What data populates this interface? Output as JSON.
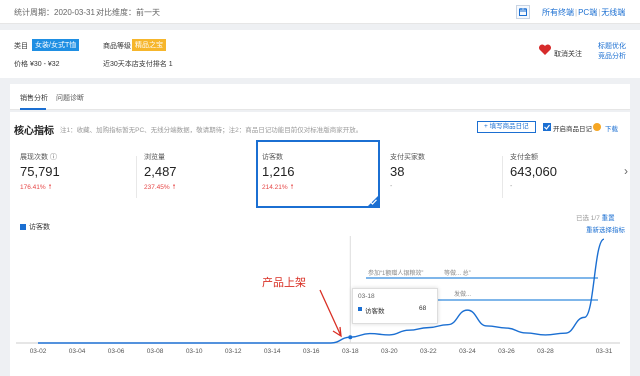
{
  "topbar": {
    "period_label": "统计周期：2020-03-31",
    "compare_label": "对比维度：前一天",
    "devices": [
      "所有终端",
      "PC端",
      "无线端"
    ]
  },
  "info": {
    "category_label": "类目",
    "category_tag": "女装/女式T恤",
    "level_label": "商品等级",
    "level_tag": "精品之宝",
    "price": "价格  ¥30 - ¥32",
    "rank": "近30天本店支付排名  1",
    "follow": "取消关注",
    "link1": "标题优化",
    "link2": "竞品分析"
  },
  "tabs": [
    "销售分析",
    "问题诊断"
  ],
  "panel": {
    "title": "核心指标",
    "note": "注1：收藏、加购指标暂无PC、无线分端数据，敬请期待；注2：商品日记功能目前仅对标准版商家开放。",
    "add_diary": "+ 填写商品日记",
    "show_diary": "开启商品日记",
    "download": "下载",
    "legend": "访客数",
    "chosen_prefix": "已选 1/7 ",
    "reset": "重置",
    "replace": "重新选择指标",
    "annotation": "产品上架"
  },
  "metrics": [
    {
      "label": "展现次数 ⓘ",
      "value": "75,791",
      "change": "176.41%"
    },
    {
      "label": "浏览量",
      "value": "2,487",
      "change": "237.45%"
    },
    {
      "label": "访客数",
      "value": "1,216",
      "change": "214.21%"
    },
    {
      "label": "支付买家数",
      "value": "38",
      "change": ""
    },
    {
      "label": "支付金额",
      "value": "643,060",
      "change": ""
    }
  ],
  "tooltip": {
    "date": "03-18",
    "key": "访客数",
    "value": "68"
  },
  "grey_notes": [
    "参加“1额赠人银粮效”",
    "发做...",
    "等做... 总”"
  ],
  "colors": {
    "accent": "#1b6fd2",
    "up": "#e64545",
    "line": "#1b6fd2"
  },
  "chart_data": {
    "type": "line",
    "categories": [
      "03-02",
      "03-03",
      "03-04",
      "03-05",
      "03-06",
      "03-07",
      "03-08",
      "03-09",
      "03-10",
      "03-11",
      "03-12",
      "03-13",
      "03-14",
      "03-15",
      "03-16",
      "03-17",
      "03-18",
      "03-19",
      "03-20",
      "03-21",
      "03-22",
      "03-23",
      "03-24",
      "03-25",
      "03-26",
      "03-27",
      "03-28",
      "03-29",
      "03-30",
      "03-31"
    ],
    "tick_labels": [
      "03-02",
      "03-04",
      "03-06",
      "03-08",
      "03-10",
      "03-12",
      "03-14",
      "03-16",
      "03-18",
      "03-20",
      "03-22",
      "03-24",
      "03-26",
      "03-28",
      "03-31"
    ],
    "series": [
      {
        "name": "访客数",
        "values": [
          0,
          0,
          0,
          0,
          0,
          0,
          0,
          0,
          0,
          0,
          0,
          0,
          0,
          0,
          0,
          0,
          68,
          110,
          95,
          150,
          180,
          215,
          385,
          200,
          175,
          118,
          95,
          115,
          300,
          1216
        ]
      }
    ],
    "ylim": [
      0,
      1300
    ]
  }
}
